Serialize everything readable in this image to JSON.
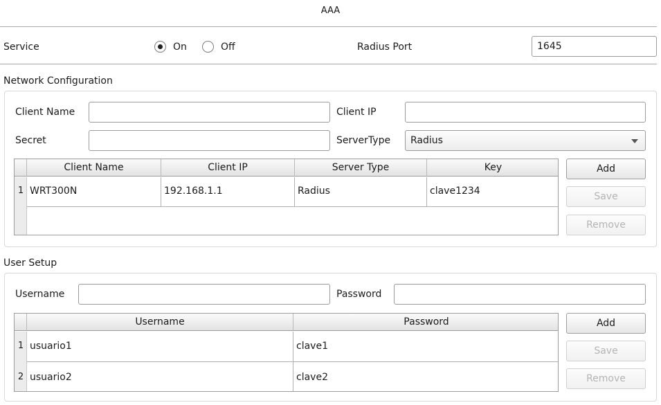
{
  "window": {
    "title": "AAA"
  },
  "service": {
    "label": "Service",
    "on_label": "On",
    "off_label": "Off",
    "selected": "On",
    "radius_port_label": "Radius Port",
    "radius_port_value": "1645"
  },
  "network": {
    "section_label": "Network Configuration",
    "client_name_label": "Client Name",
    "client_name_value": "",
    "client_ip_label": "Client IP",
    "client_ip_value": "",
    "secret_label": "Secret",
    "secret_value": "",
    "server_type_label": "ServerType",
    "server_type_value": "Radius",
    "columns": [
      "Client Name",
      "Client IP",
      "Server Type",
      "Key"
    ],
    "rows": [
      {
        "index": "1",
        "client_name": "WRT300N",
        "client_ip": "192.168.1.1",
        "server_type": "Radius",
        "key": "clave1234"
      }
    ],
    "add_label": "Add",
    "save_label": "Save",
    "remove_label": "Remove"
  },
  "users": {
    "section_label": "User Setup",
    "username_label": "Username",
    "username_value": "",
    "password_label": "Password",
    "password_value": "",
    "columns": [
      "Username",
      "Password"
    ],
    "rows": [
      {
        "index": "1",
        "username": "usuario1",
        "password": "clave1"
      },
      {
        "index": "2",
        "username": "usuario2",
        "password": "clave2"
      }
    ],
    "add_label": "Add",
    "save_label": "Save",
    "remove_label": "Remove"
  }
}
